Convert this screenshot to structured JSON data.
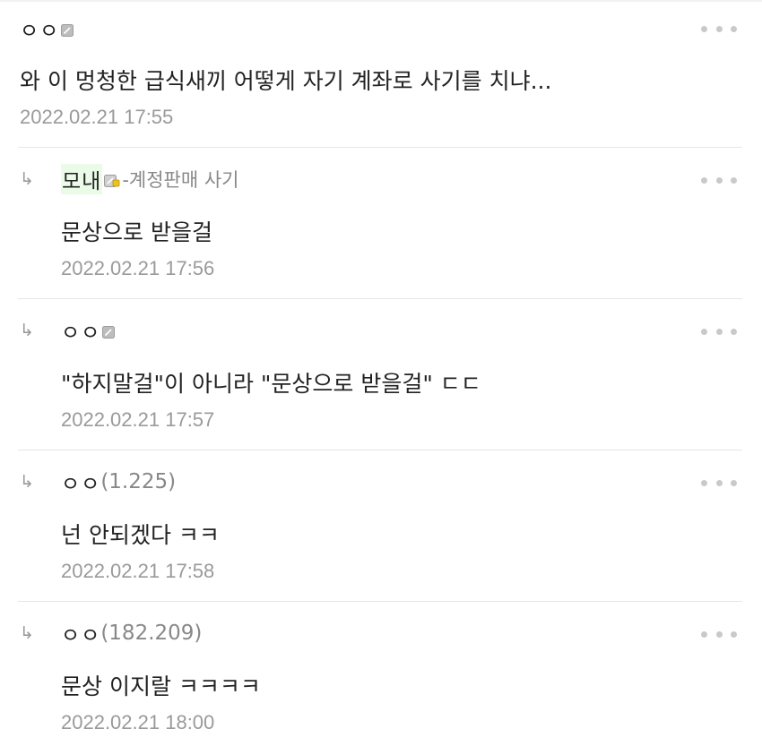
{
  "comments": [
    {
      "nickname": "ㅇㅇ",
      "badge": "fixed-nick-badge-icon",
      "text": "와 이 멍청한 급식새끼 어떻게 자기 계좌로 사기를 치냐...",
      "date": "2022.02.21 17:55"
    }
  ],
  "replies": [
    {
      "arrow": "↳",
      "nickname": "모내",
      "badge": "semi-fixed-nick-badge-icon",
      "tag": "-계정판매 사기",
      "text": "문상으로 받을걸",
      "date": "2022.02.21 17:56"
    },
    {
      "arrow": "↳",
      "nickname": "ㅇㅇ",
      "badge": "fixed-nick-badge-icon",
      "text": "\"하지말걸\"이 아니라 \"문상으로 받을걸\" ㄷㄷ",
      "date": "2022.02.21 17:57"
    },
    {
      "arrow": "↳",
      "nickname": "ㅇㅇ",
      "ip": "(1.225)",
      "text": "넌 안되겠다 ㅋㅋ",
      "date": "2022.02.21 17:58"
    },
    {
      "arrow": "↳",
      "nickname": "ㅇㅇ",
      "ip": "(182.209)",
      "text": "문상 이지랄 ㅋㅋㅋㅋ",
      "date": "2022.02.21 18:00"
    }
  ],
  "icons": {
    "more": "more-options-icon",
    "reply": "reply-arrow-icon"
  },
  "colors": {
    "nick_highlight": "#eafbe8",
    "meta_gray": "#9a9a9a",
    "text": "#222222"
  }
}
